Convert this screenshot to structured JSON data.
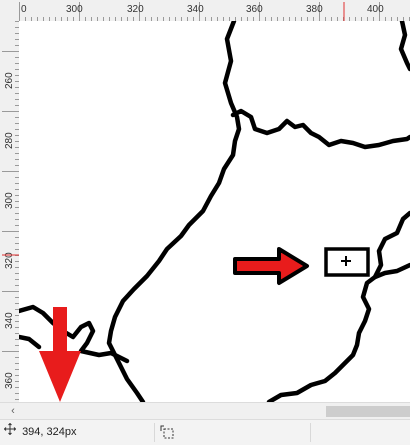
{
  "rulers": {
    "horizontal_labels": [
      "0",
      "300",
      "320",
      "340",
      "360",
      "380",
      "400"
    ],
    "vertical_labels": [
      "260",
      "280",
      "300",
      "320",
      "340",
      "360"
    ],
    "cursor_marker_color": "#e03030"
  },
  "canvas": {
    "map_outline_color": "#000000",
    "annotation_arrow_color": "#e81c1c",
    "background": "#ffffff"
  },
  "scrollbar": {
    "left_arrow": "‹"
  },
  "status": {
    "cursor_position": "394, 324px",
    "move_icon": "move-cross-icon",
    "selection_icon": "selection-size-icon"
  }
}
